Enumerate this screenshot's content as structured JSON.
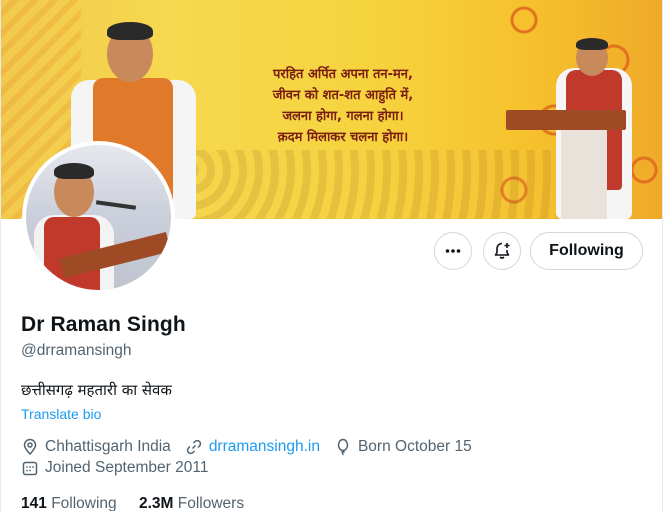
{
  "banner": {
    "quote_lines": [
      "परहित अर्पित अपना तन-मन,",
      "जीवन को शत-शत आहुति में,",
      "जलना होगा, गलना होगा।",
      "क़दम मिलाकर चलना होगा।"
    ]
  },
  "actions": {
    "more_icon": "more-horizontal-icon",
    "notify_icon": "bell-plus-icon",
    "follow_label": "Following"
  },
  "profile": {
    "name": "Dr Raman Singh",
    "handle": "@drramansingh",
    "bio": "छत्तीसगढ़ महतारी का सेवक",
    "translate_label": "Translate bio",
    "location": "Chhattisgarh India",
    "website": "drramansingh.in",
    "birthday": "Born October 15",
    "joined": "Joined September 2011"
  },
  "stats": {
    "following_count": "141",
    "following_label": "Following",
    "followers_count": "2.3M",
    "followers_label": "Followers"
  },
  "colors": {
    "accent": "#1d9bf0",
    "muted_text": "#536471",
    "border": "#cfd9de"
  }
}
